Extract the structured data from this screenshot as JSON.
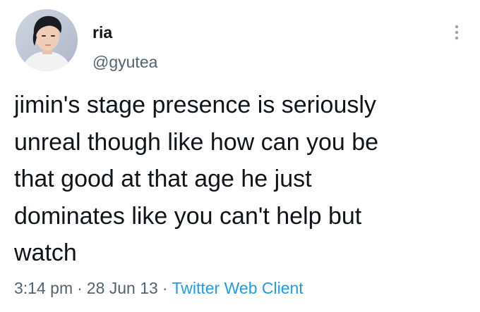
{
  "tweet": {
    "author": {
      "display_name": "ria",
      "handle": "@gyutea",
      "avatar": "profile-photo"
    },
    "more_icon": "vertical-ellipsis-icon",
    "text": "jimin's stage presence is seriously\nunreal though like how can you be\nthat good at that age he just\ndominates like you can't help but\nwatch",
    "time": "3:14 pm",
    "separator": "·",
    "date": "28 Jun 13",
    "source": "Twitter Web Client"
  },
  "colors": {
    "text_primary": "#0f1419",
    "text_secondary": "#536471",
    "accent": "#1d9bf0",
    "background": "#ffffff"
  }
}
